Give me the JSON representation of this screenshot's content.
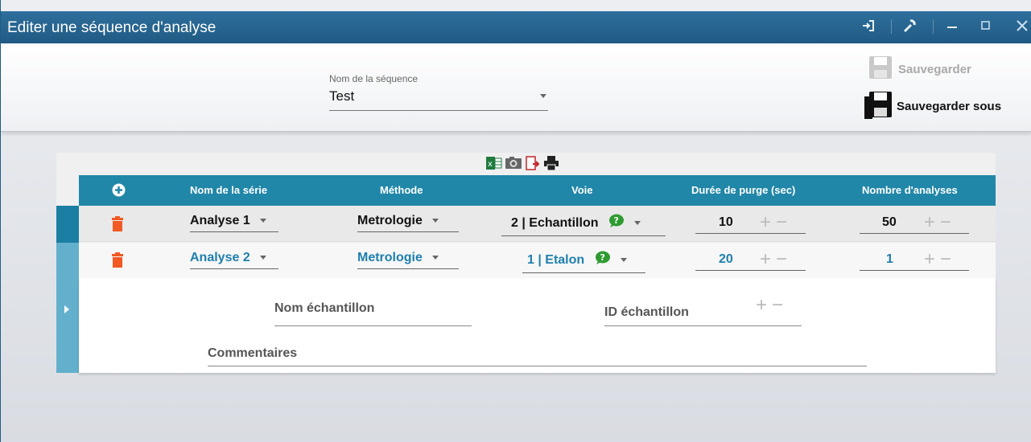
{
  "window": {
    "title": "Editer une séquence d'analyse",
    "controls": [
      "exit-icon",
      "wrench-icon",
      "minimize-icon",
      "maximize-icon",
      "close-icon"
    ]
  },
  "header": {
    "sequence_label": "Nom de la séquence",
    "sequence_value": "Test",
    "save_label": "Sauvegarder",
    "save_as_label": "Sauvegarder sous"
  },
  "toolbar": {
    "icons": [
      "excel-icon",
      "camera-icon",
      "export-pdf-icon",
      "print-icon"
    ]
  },
  "table": {
    "columns": [
      "Nom de la série",
      "Méthode",
      "Voie",
      "Durée de purge (sec)",
      "Nombre d'analyses"
    ],
    "rows": [
      {
        "serie": "Analyse 1",
        "methode": "Metrologie",
        "voie": "2 | Echantillon",
        "purge": "10",
        "nombre": "50",
        "selected": true
      },
      {
        "serie": "Analyse 2",
        "methode": "Metrologie",
        "voie": "1 | Etalon",
        "purge": "20",
        "nombre": "1",
        "selected": false
      }
    ]
  },
  "detail": {
    "nom_echantillon": "Nom échantillon",
    "id_echantillon": "ID échantillon",
    "commentaires": "Commentaires"
  },
  "colors": {
    "titlebar": "#2a6790",
    "table_header": "#2187a8",
    "accent_text": "#1f7fae",
    "delete_icon": "#f15a24",
    "help_icon": "#2e9b31"
  }
}
